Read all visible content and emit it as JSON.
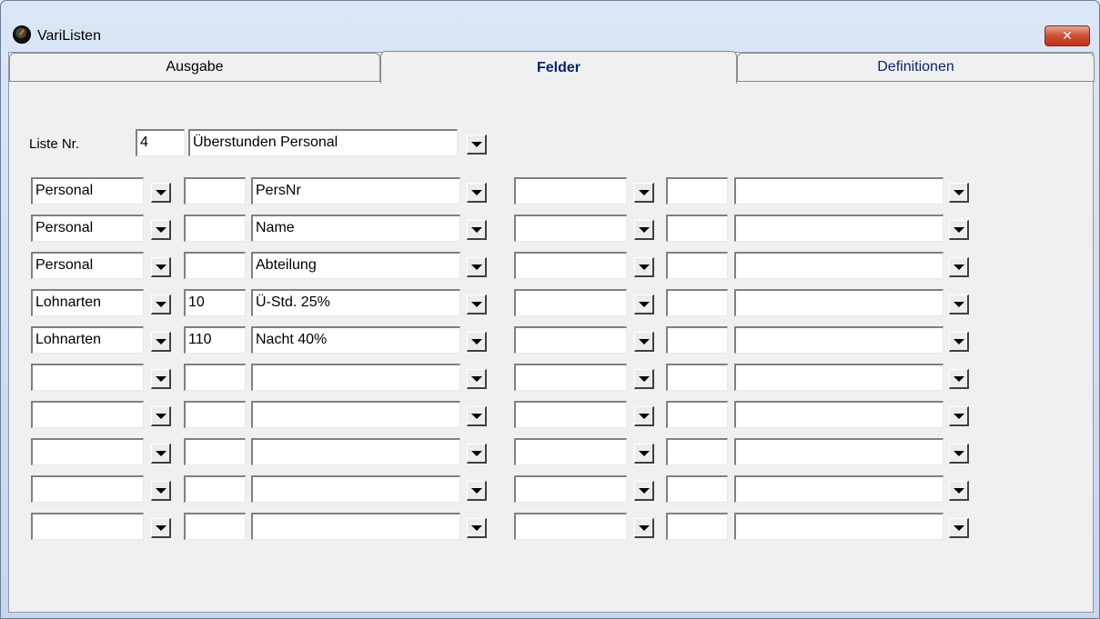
{
  "window": {
    "title": "VariListen",
    "close_glyph": "✕"
  },
  "tabs": [
    {
      "label": "Ausgabe"
    },
    {
      "label": "Felder"
    },
    {
      "label": "Definitionen"
    }
  ],
  "list": {
    "label": "Liste Nr.",
    "number": "4",
    "name": "Überstunden Personal"
  },
  "rows": [
    {
      "source": "Personal",
      "nr": "",
      "field": "PersNr"
    },
    {
      "source": "Personal",
      "nr": "",
      "field": "Name"
    },
    {
      "source": "Personal",
      "nr": "",
      "field": "Abteilung"
    },
    {
      "source": "Lohnarten",
      "nr": "10",
      "field": "Ü-Std. 25%"
    },
    {
      "source": "Lohnarten",
      "nr": "110",
      "field": "Nacht 40%"
    },
    {
      "source": "",
      "nr": "",
      "field": ""
    },
    {
      "source": "",
      "nr": "",
      "field": ""
    },
    {
      "source": "",
      "nr": "",
      "field": ""
    },
    {
      "source": "",
      "nr": "",
      "field": ""
    },
    {
      "source": "",
      "nr": "",
      "field": ""
    }
  ],
  "rows_right": [
    {
      "source": "",
      "nr": "",
      "field": ""
    },
    {
      "source": "",
      "nr": "",
      "field": ""
    },
    {
      "source": "",
      "nr": "",
      "field": ""
    },
    {
      "source": "",
      "nr": "",
      "field": ""
    },
    {
      "source": "",
      "nr": "",
      "field": ""
    },
    {
      "source": "",
      "nr": "",
      "field": ""
    },
    {
      "source": "",
      "nr": "",
      "field": ""
    },
    {
      "source": "",
      "nr": "",
      "field": ""
    },
    {
      "source": "",
      "nr": "",
      "field": ""
    },
    {
      "source": "",
      "nr": "",
      "field": ""
    }
  ]
}
